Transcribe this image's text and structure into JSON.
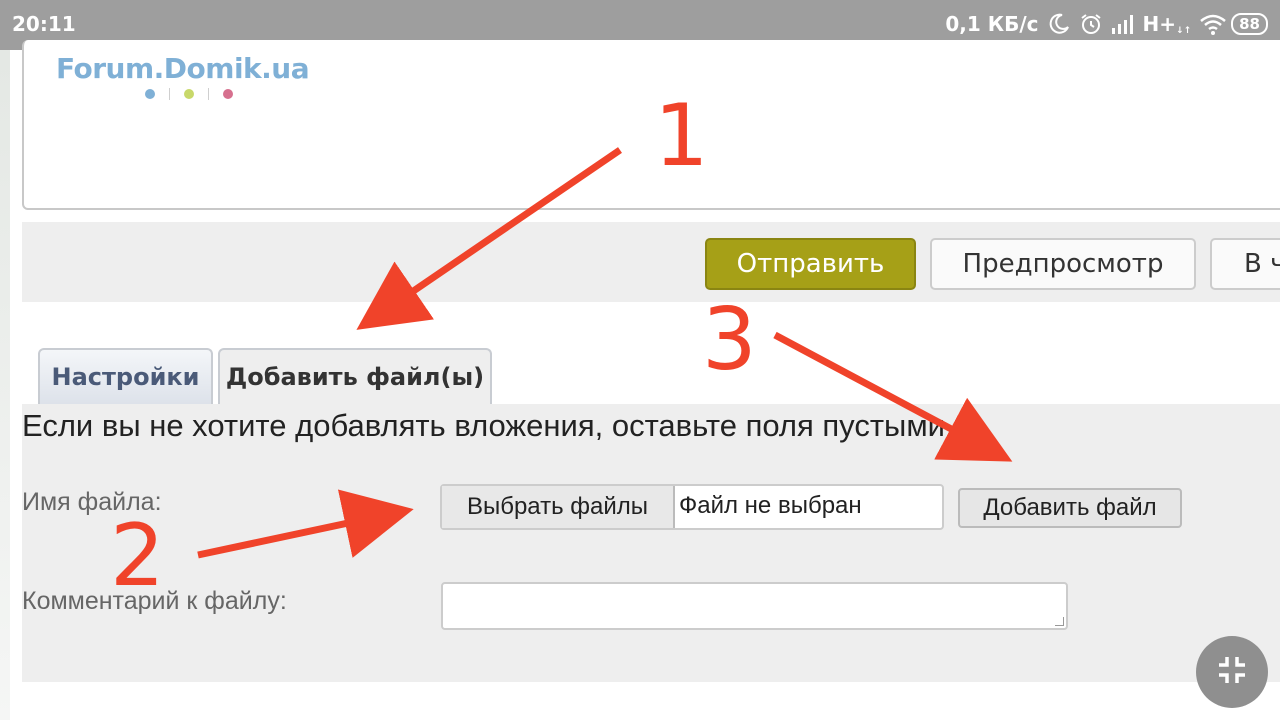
{
  "status_bar": {
    "time": "20:11",
    "speed": "0,1 КБ/с",
    "network": "H+",
    "network_sub": "↓↑",
    "battery": "88",
    "icons": [
      "moon-icon",
      "alarm-icon",
      "signal-icon",
      "wifi-icon",
      "battery-icon"
    ]
  },
  "logo": {
    "text": "Forum.Domik.ua",
    "dot_colors": [
      "#7fb0d6",
      "#c8d86a",
      "#d6708e"
    ]
  },
  "actions": {
    "send": "Отправить",
    "preview": "Предпросмотр",
    "more": "В ч"
  },
  "tabs": [
    {
      "label": "Настройки",
      "active": false
    },
    {
      "label": "Добавить файл(ы)",
      "active": true
    }
  ],
  "attach": {
    "hint": "Если вы не хотите добавлять вложения, оставьте поля пустыми",
    "file_label": "Имя файла:",
    "choose_button": "Выбрать файлы",
    "no_file": "Файл не выбран",
    "add_button": "Добавить файл",
    "comment_label": "Комментарий к файлу:",
    "comment_value": ""
  },
  "annotations": {
    "numbers": [
      "1",
      "2",
      "3"
    ],
    "color": "#f0432a"
  },
  "colors": {
    "send_button": "#a6a017",
    "status_bar": "#9e9e9e",
    "panel": "#eeeeee"
  }
}
